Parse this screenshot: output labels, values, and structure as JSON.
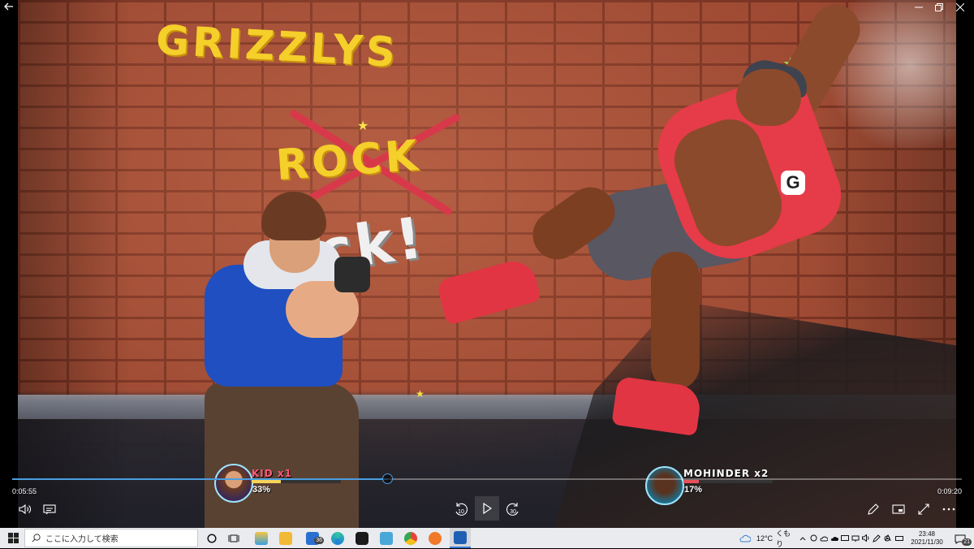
{
  "window": {
    "back_icon": "arrow-left-icon",
    "minimize_icon": "minimize-icon",
    "restore_icon": "restore-icon",
    "close_icon": "close-icon"
  },
  "video_scene": {
    "graffiti_main": "GRIZZLYS",
    "graffiti_crossed": "ROCK",
    "graffiti_white": "ck!",
    "emblem_letter": "G"
  },
  "game_hud": {
    "player1": {
      "name": "KID",
      "lives": "x1",
      "percent": "33%",
      "health_fraction": 0.33,
      "name_color": "#ff5a7a",
      "bar_color": "#f6d35a"
    },
    "player2": {
      "name": "MOHINDER",
      "lives": "x2",
      "percent": "17%",
      "health_fraction": 0.17,
      "name_color": "#ffffff",
      "bar_color": "#e8505b"
    }
  },
  "player": {
    "elapsed": "0:05:55",
    "duration": "0:09:20",
    "progress_fraction": 0.395,
    "accent_color": "#4a9ee0",
    "controls": {
      "volume_icon": "volume-icon",
      "subtitles_icon": "subtitles-icon",
      "rewind_label": "10",
      "rewind_icon": "rewind-10-icon",
      "play_icon": "play-icon",
      "forward_label": "30",
      "forward_icon": "forward-30-icon",
      "edit_icon": "pencil-icon",
      "miniview_icon": "mini-view-icon",
      "fullscreen_icon": "fullscreen-icon",
      "more_icon": "more-options-icon"
    }
  },
  "taskbar": {
    "search_placeholder": "ここに入力して検索",
    "mail_badge": "36",
    "weather_temp": "12°C",
    "weather_desc": "くもり",
    "ime_label": "A",
    "clock_time": "23:48",
    "clock_date": "2021/11/30",
    "notification_count": "21"
  }
}
